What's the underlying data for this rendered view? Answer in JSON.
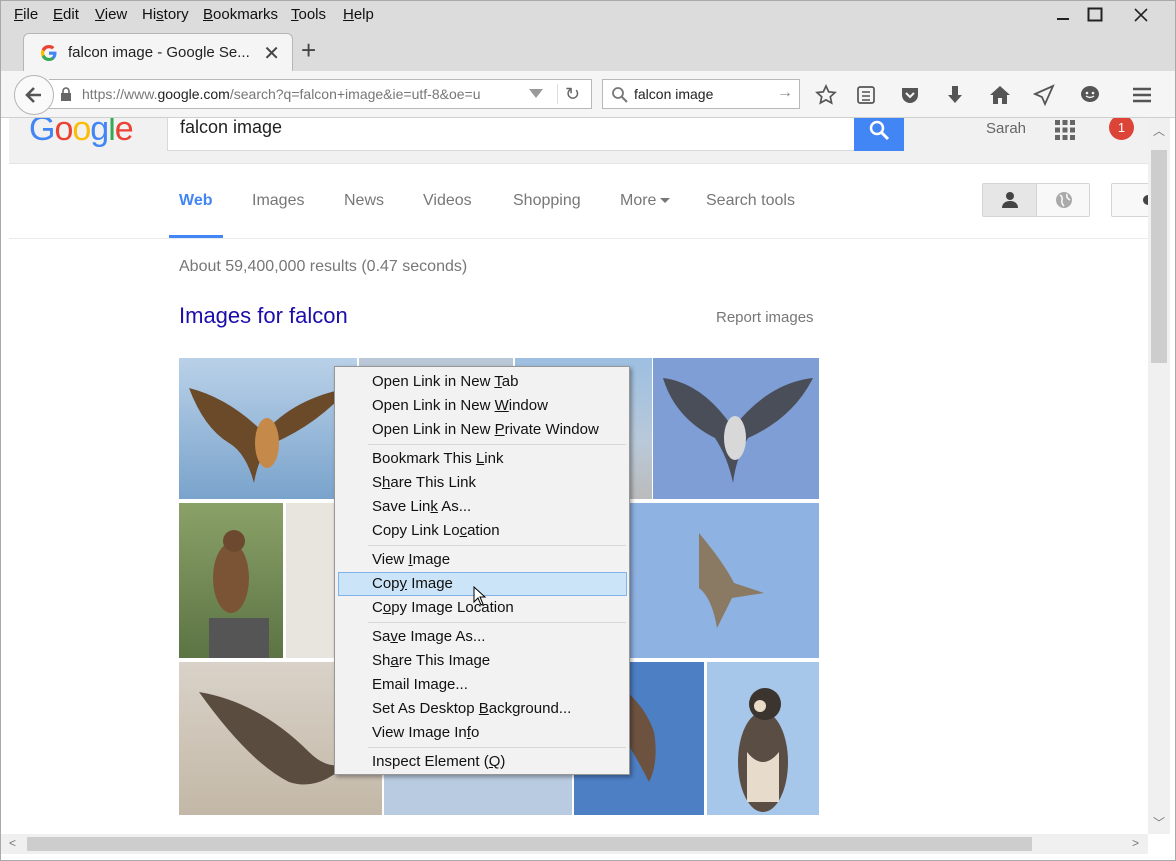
{
  "menubar": {
    "items": [
      {
        "pre": "",
        "key": "F",
        "post": "ile"
      },
      {
        "pre": "",
        "key": "E",
        "post": "dit"
      },
      {
        "pre": "",
        "key": "V",
        "post": "iew"
      },
      {
        "pre": "Hi",
        "key": "s",
        "post": "tory"
      },
      {
        "pre": "",
        "key": "B",
        "post": "ookmarks"
      },
      {
        "pre": "",
        "key": "T",
        "post": "ools"
      },
      {
        "pre": "",
        "key": "H",
        "post": "elp"
      }
    ]
  },
  "tab": {
    "title": "falcon image - Google Se..."
  },
  "navbar": {
    "url_prefix": "https://www.",
    "url_domain": "google.com",
    "url_rest": "/search?q=falcon+image&ie=utf-8&oe=u",
    "search_value": "falcon image"
  },
  "google": {
    "logo": [
      "G",
      "o",
      "o",
      "g",
      "l",
      "e"
    ],
    "logo_colors": [
      "#4285f4",
      "#ea4335",
      "#fbbc05",
      "#4285f4",
      "#34a853",
      "#ea4335"
    ],
    "query": "falcon image",
    "user": "Sarah",
    "notif_count": "1",
    "tabs": [
      "Web",
      "Images",
      "News",
      "Videos",
      "Shopping",
      "More",
      "Search tools"
    ],
    "stats": "About 59,400,000 results (0.47 seconds)",
    "images_title": "Images for falcon",
    "report": "Report images"
  },
  "context_menu": {
    "groups": [
      [
        {
          "pre": "Open Link in New ",
          "key": "T",
          "post": "ab"
        },
        {
          "pre": "Open Link in New ",
          "key": "W",
          "post": "indow"
        },
        {
          "pre": "Open Link in New ",
          "key": "P",
          "post": "rivate Window"
        }
      ],
      [
        {
          "pre": "Bookmark This ",
          "key": "L",
          "post": "ink"
        },
        {
          "pre": "S",
          "key": "h",
          "post": "are This Link"
        },
        {
          "pre": "Save Lin",
          "key": "k",
          "post": " As..."
        },
        {
          "pre": "Copy Link Lo",
          "key": "c",
          "post": "ation"
        }
      ],
      [
        {
          "pre": "View ",
          "key": "I",
          "post": "mage"
        },
        {
          "pre": "Cop",
          "key": "y",
          "post": " Image",
          "highlight": true
        },
        {
          "pre": "C",
          "key": "o",
          "post": "py Image Location"
        }
      ],
      [
        {
          "pre": "Sa",
          "key": "v",
          "post": "e Image As..."
        },
        {
          "pre": "Sh",
          "key": "a",
          "post": "re This Image"
        },
        {
          "pre": "Email Ima",
          "key": "g",
          "post": "e..."
        },
        {
          "pre": "Set As Desktop ",
          "key": "B",
          "post": "ackground..."
        },
        {
          "pre": "View Image In",
          "key": "f",
          "post": "o"
        }
      ],
      [
        {
          "pre": "Inspect Element (",
          "key": "Q",
          "post": ")"
        }
      ]
    ]
  }
}
